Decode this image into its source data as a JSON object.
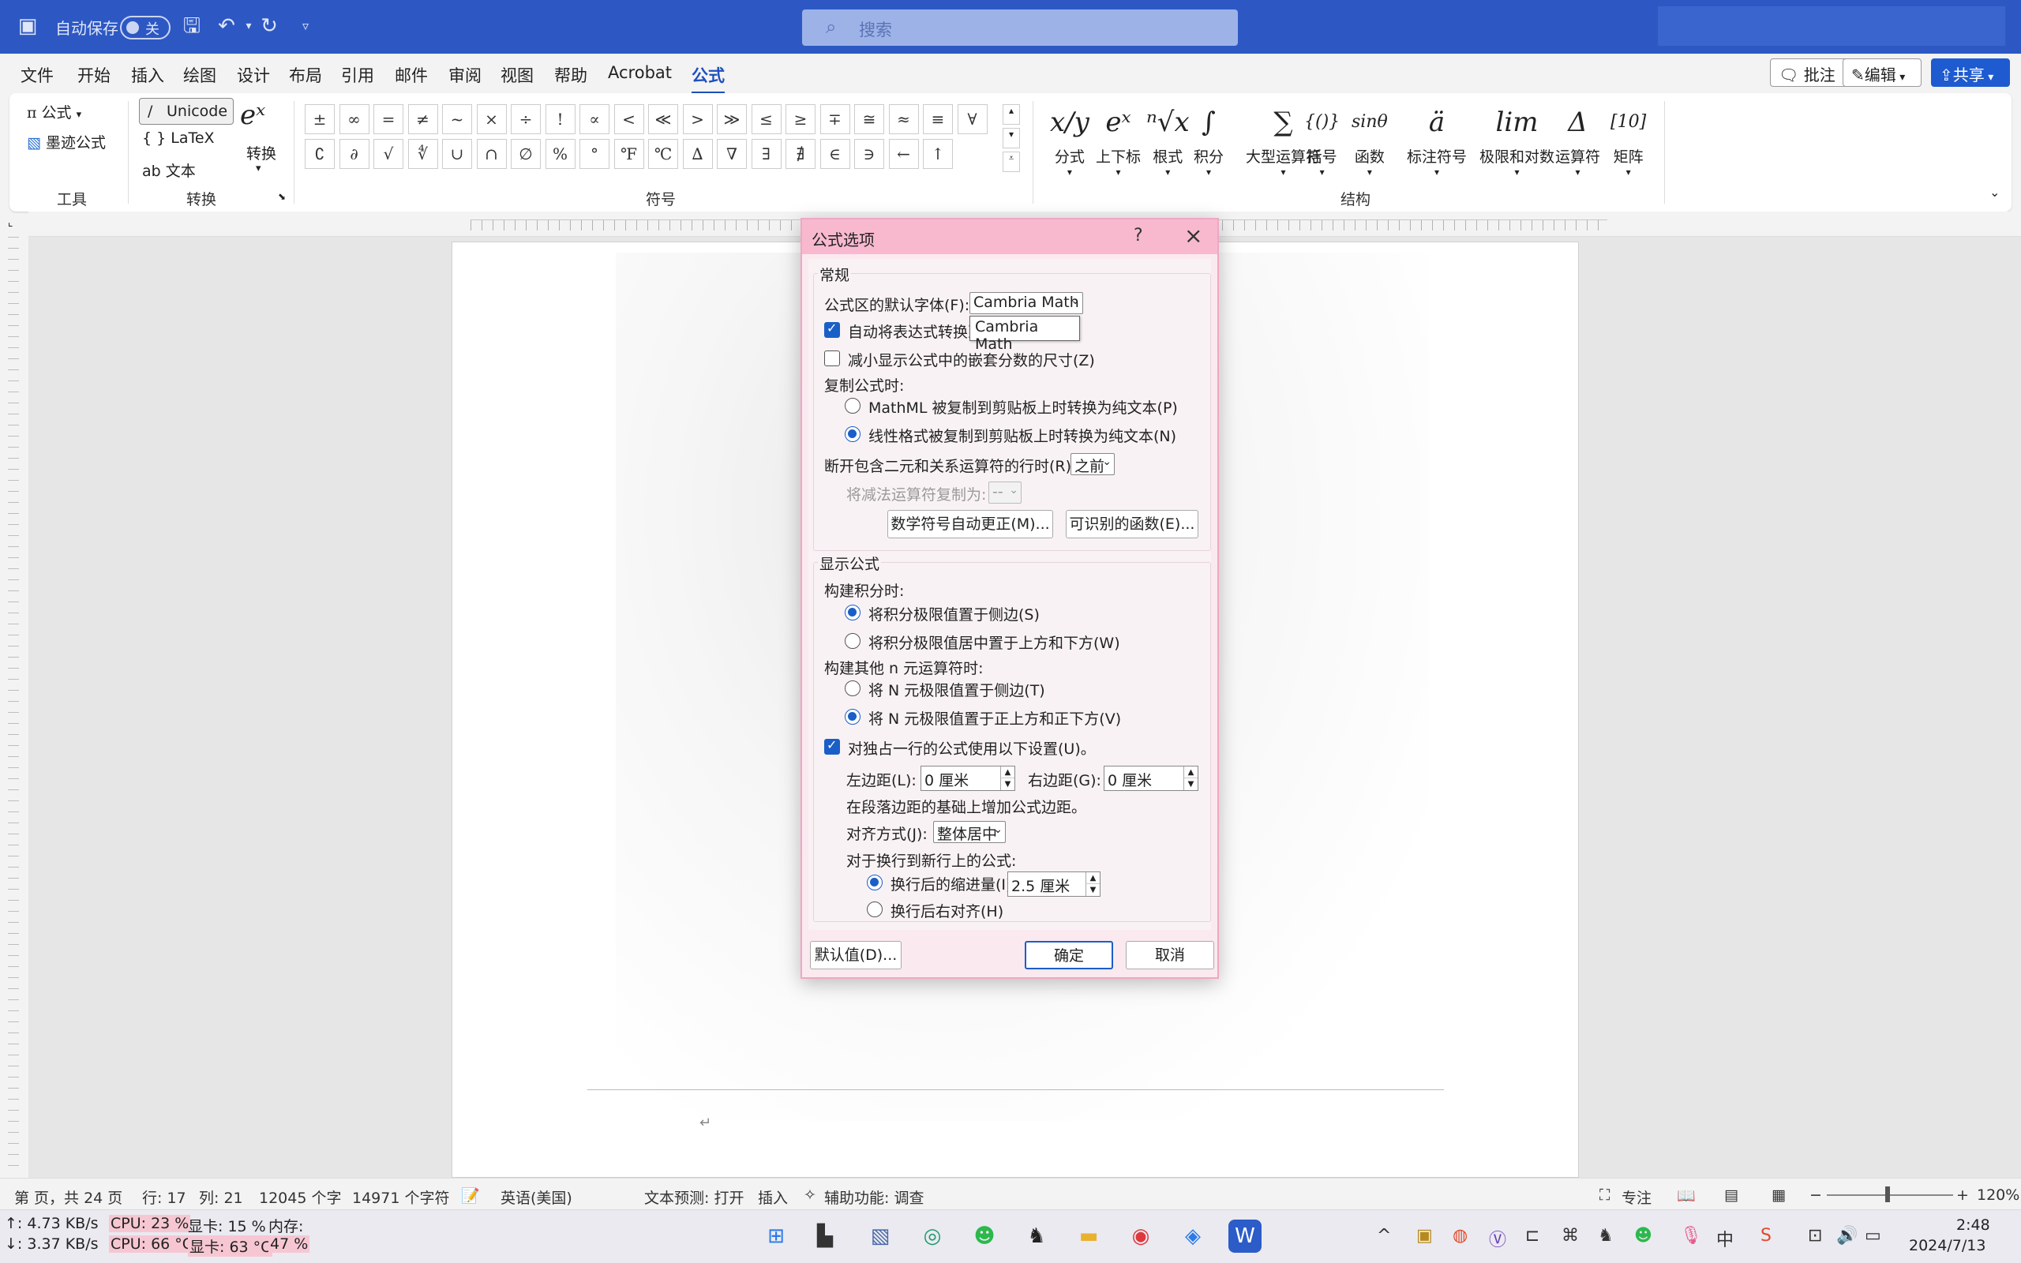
{
  "titlebar": {
    "autosave_label": "自动保存",
    "autosave_state": "关",
    "search_placeholder": "搜索"
  },
  "menu": {
    "tabs": [
      "文件",
      "开始",
      "插入",
      "绘图",
      "设计",
      "布局",
      "引用",
      "邮件",
      "审阅",
      "视图",
      "帮助",
      "Acrobat",
      "公式"
    ],
    "active": "公式",
    "comment_btn": "批注",
    "edit_btn": "编辑",
    "share_btn": "共享"
  },
  "ribbon": {
    "tools": {
      "equation": "公式",
      "ink_equation": "墨迹公式",
      "group_label": "工具"
    },
    "convert": {
      "unicode": "Unicode",
      "latex": "LaTeX",
      "text": "文本",
      "convert": "转换",
      "group_label": "转换"
    },
    "symbols": {
      "row1": [
        "±",
        "∞",
        "=",
        "≠",
        "~",
        "×",
        "÷",
        "!",
        "∝",
        "<",
        "≪",
        ">",
        "≫",
        "≤",
        "≥",
        "∓",
        "≅",
        "≈",
        "≡",
        "∀"
      ],
      "row2": [
        "∁",
        "∂",
        "√",
        "∜",
        "∪",
        "∩",
        "∅",
        "%",
        "°",
        "℉",
        "℃",
        "∆",
        "∇",
        "∃",
        "∄",
        "∈",
        "∋",
        "←",
        "↑"
      ],
      "group_label": "符号"
    },
    "structures": {
      "items": [
        {
          "glyph": "x/y",
          "label": "分式"
        },
        {
          "glyph": "eˣ",
          "label": "上下标"
        },
        {
          "glyph": "ⁿ√x",
          "label": "根式"
        },
        {
          "glyph": "∫",
          "label": "积分"
        },
        {
          "glyph": "∑",
          "label": "大型运算符"
        },
        {
          "glyph": "{()}",
          "label": "括号"
        },
        {
          "glyph": "sinθ",
          "label": "函数"
        },
        {
          "glyph": "ä",
          "label": "标注符号"
        },
        {
          "glyph": "lim",
          "label": "极限和对数"
        },
        {
          "glyph": "Δ",
          "label": "运算符"
        },
        {
          "glyph": "[10]",
          "label": "矩阵"
        }
      ],
      "group_label": "结构"
    }
  },
  "dialog": {
    "title": "公式选项",
    "help": "?",
    "general_legend": "常规",
    "default_font_label": "公式区的默认字体(F):",
    "default_font_value": "Cambria Math",
    "tooltip": "Cambria Math",
    "auto_convert": "自动将表达式转换到",
    "reduce_nested": "减小显示公式中的嵌套分数的尺寸(Z)",
    "copy_label": "复制公式时:",
    "copy_mathml": "MathML 被复制到剪贴板上时转换为纯文本(P)",
    "copy_linear": "线性格式被复制到剪贴板上时转换为纯文本(N)",
    "break_label": "断开包含二元和关系运算符的行时(R):",
    "break_value": "之前",
    "dup_minus_label": "将减法运算符复制为:",
    "dup_minus_value": "--",
    "autocorrect_btn": "数学符号自动更正(M)...",
    "functions_btn": "可识别的函数(E)...",
    "display_legend": "显示公式",
    "integral_label": "构建积分时:",
    "integral_side": "将积分极限值置于侧边(S)",
    "integral_center": "将积分极限值居中置于上方和下方(W)",
    "nary_label": "构建其他 n 元运算符时:",
    "nary_side": "将 N 元极限值置于侧边(T)",
    "nary_center": "将 N 元极限值置于正上方和正下方(V)",
    "standalone": "对独占一行的公式使用以下设置(U)。",
    "left_margin_label": "左边距(L):",
    "left_margin_value": "0 厘米",
    "right_margin_label": "右边距(G):",
    "right_margin_value": "0 厘米",
    "margin_note": "在段落边距的基础上增加公式边距。",
    "align_label": "对齐方式(J):",
    "align_value": "整体居中",
    "wrap_label": "对于换行到新行上的公式:",
    "indent_label": "换行后的缩进量(I):",
    "indent_value": "2.5 厘米",
    "right_align": "换行后右对齐(H)",
    "defaults_btn": "默认值(D)...",
    "ok_btn": "确定",
    "cancel_btn": "取消"
  },
  "statusbar": {
    "page": "第 页，共 24 页",
    "line": "行: 17",
    "col": "列: 21",
    "words": "12045 个字",
    "chars": "14971 个字符",
    "language": "英语(美国)",
    "text_predict": "文本预测: 打开",
    "insert": "插入",
    "accessibility": "辅助功能: 调查",
    "focus": "专注",
    "zoom": "120%"
  },
  "taskbar": {
    "net_up": "↑: 4.73 KB/s",
    "net_down": "↓: 3.37 KB/s",
    "cpu_load": "CPU: 23 %",
    "cpu_temp": "CPU: 66 °C",
    "gpu_load": "显卡: 15 %",
    "gpu_temp": "显卡: 63 °C",
    "mem_label": "内存:",
    "mem_value": "47 %",
    "time": "2:48",
    "date": "2024/7/13"
  }
}
